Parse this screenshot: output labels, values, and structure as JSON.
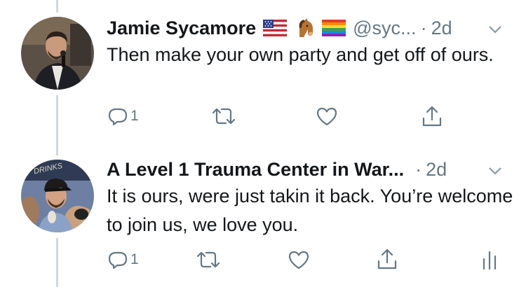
{
  "tweets": [
    {
      "name": "Jamie Sycamore",
      "handle": "@syc...",
      "dot": "·",
      "time": "2d",
      "emojis": [
        "us-flag-icon",
        "horse-icon",
        "rainbow-flag-icon"
      ],
      "text": "Then make your own party and get off of ours.",
      "reply_count": "1"
    },
    {
      "name": "A Level 1 Trauma Center in War...",
      "dot": "·",
      "time": "2d",
      "avatar_sign_text": "DRINKS",
      "text": "It is ours, were just takin it back. You’re welcome to join us, we love you.",
      "reply_count": "1"
    }
  ],
  "colors": {
    "text": "#14171a",
    "muted": "#657786",
    "thread_line": "#cfd9de"
  }
}
